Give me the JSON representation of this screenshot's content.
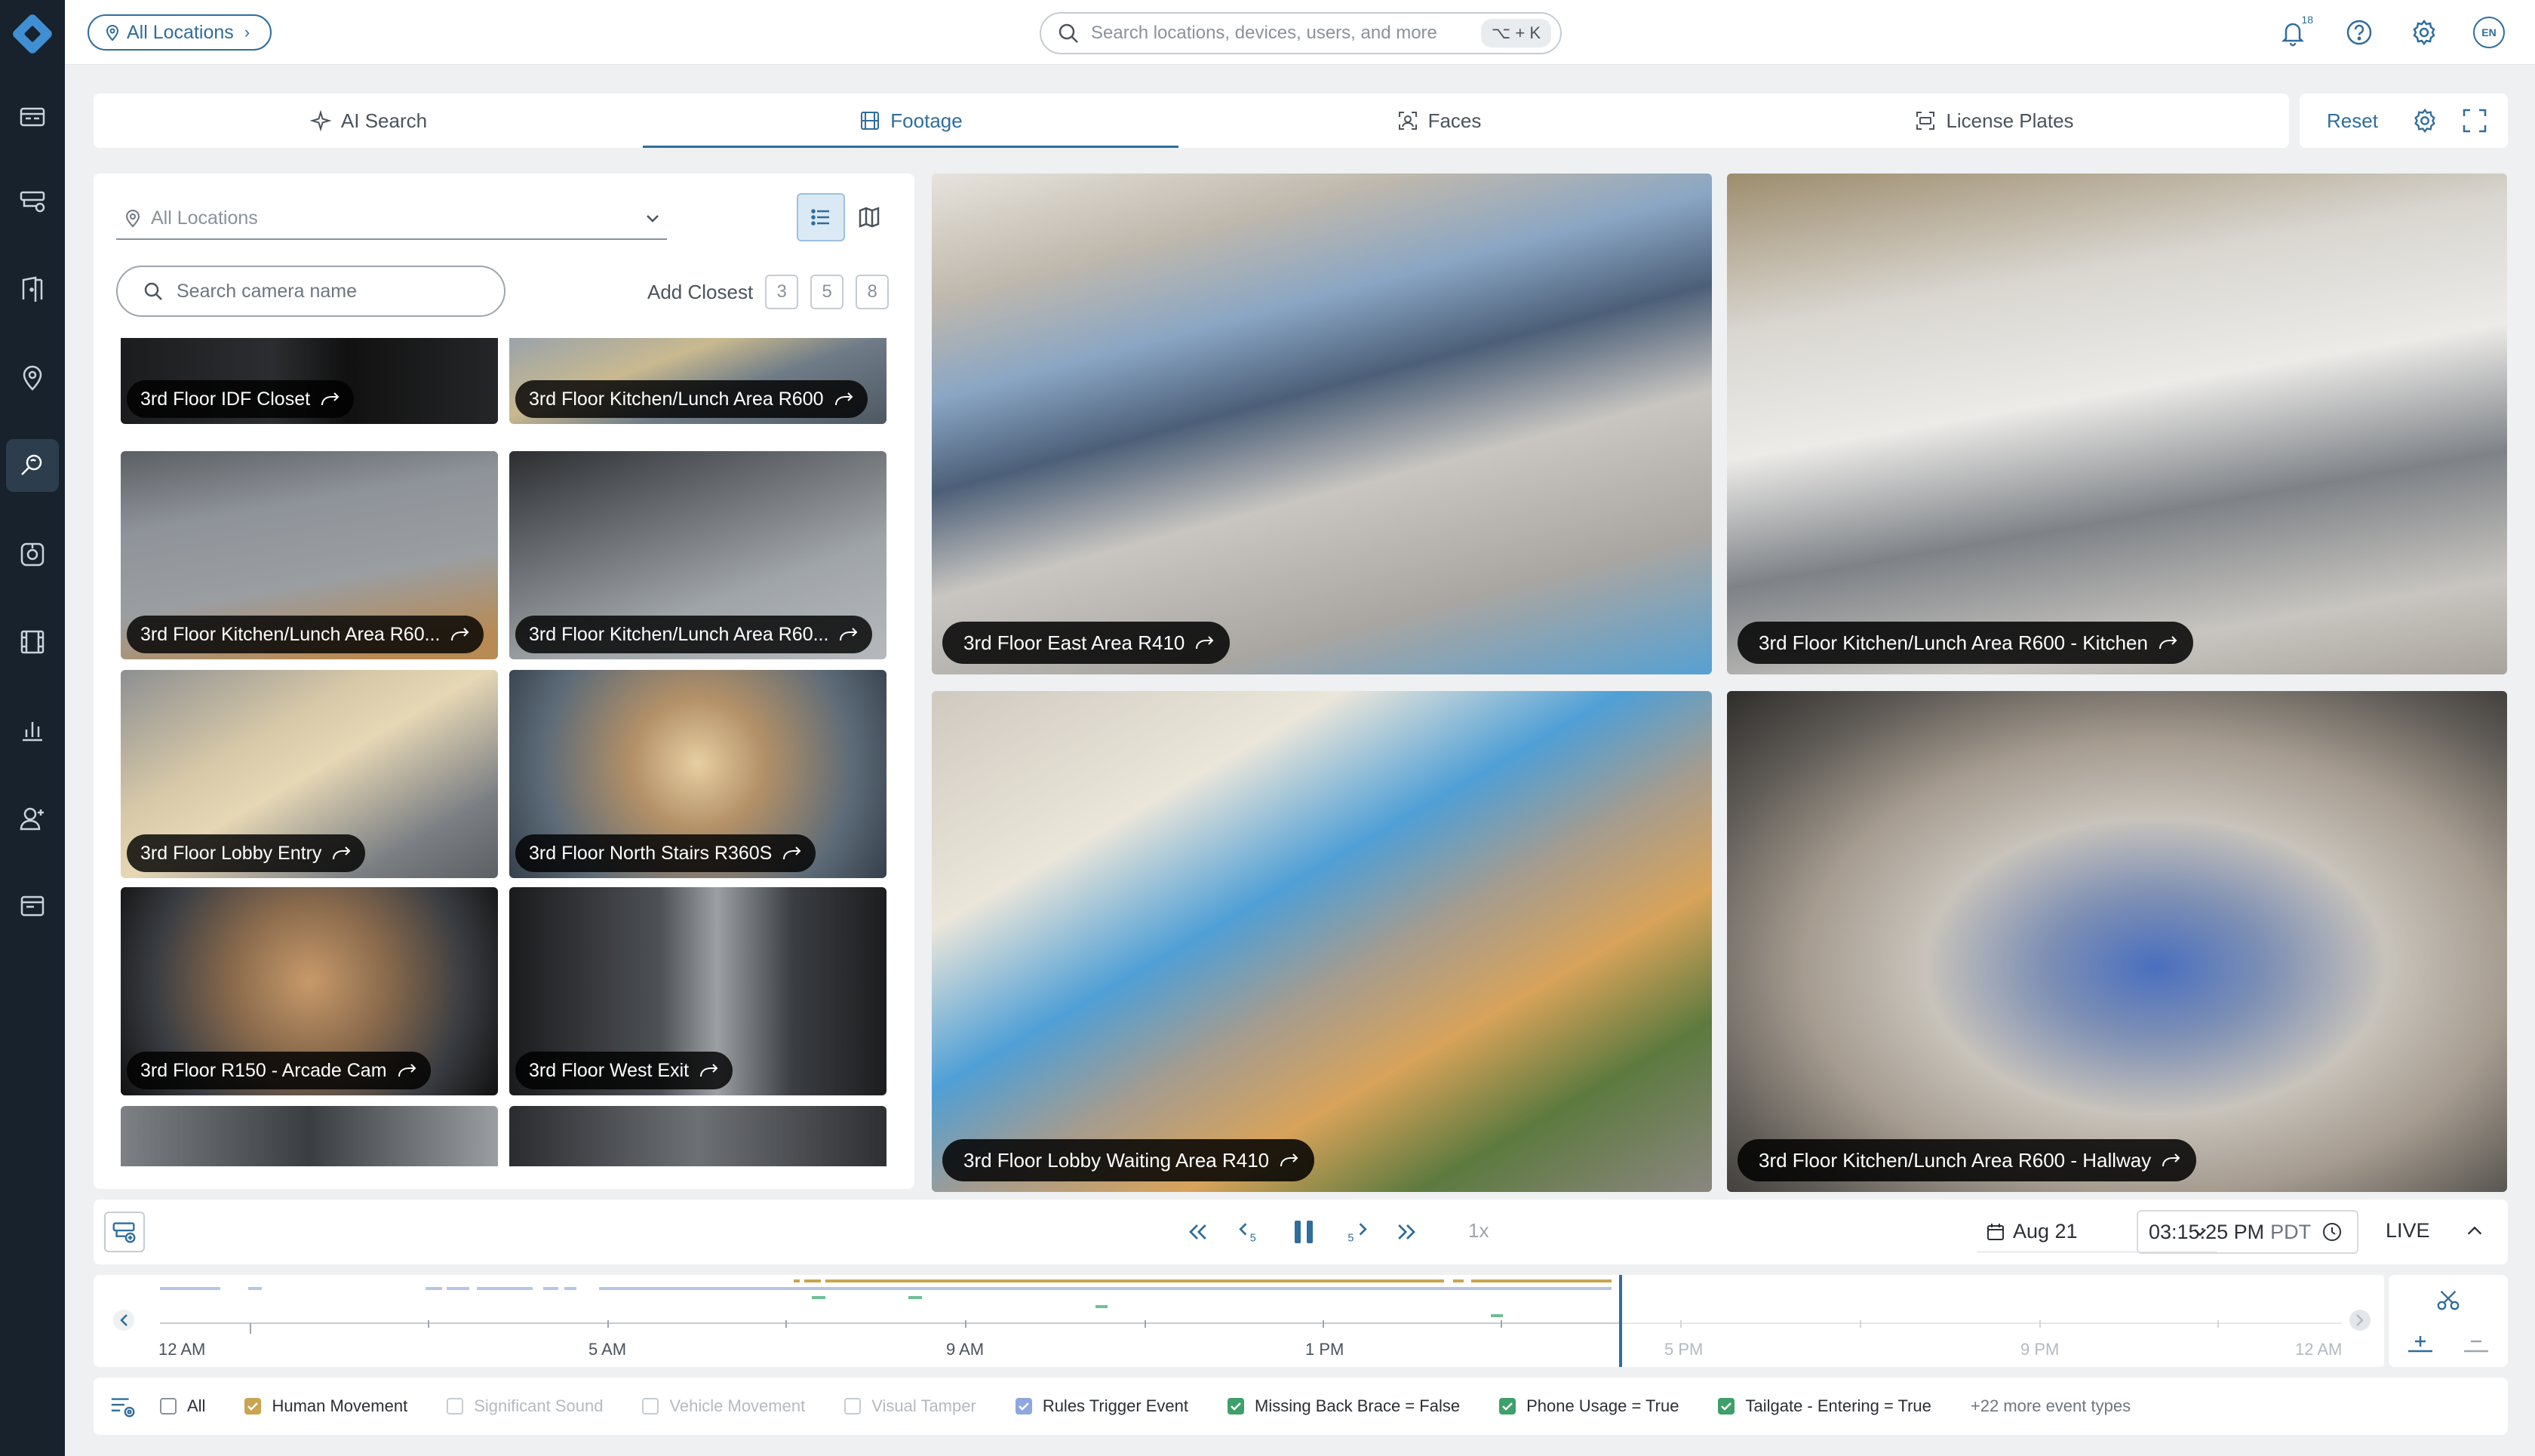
{
  "rail": {
    "items": [
      {
        "name": "dashboard-icon",
        "active": false
      },
      {
        "name": "devices-icon",
        "active": false
      },
      {
        "name": "access-door-icon",
        "active": false
      },
      {
        "name": "locations-pin-icon",
        "active": false
      },
      {
        "name": "investigate-search-icon",
        "active": true
      },
      {
        "name": "alarms-icon",
        "active": false
      },
      {
        "name": "footage-film-icon",
        "active": false
      },
      {
        "name": "analytics-chart-icon",
        "active": false
      },
      {
        "name": "add-user-icon",
        "active": false
      },
      {
        "name": "apps-window-icon",
        "active": false
      }
    ]
  },
  "topbar": {
    "location_label": "All Locations",
    "search_placeholder": "Search locations, devices, users, and more",
    "shortcut": "⌥ + K",
    "notification_count": "18",
    "language": "EN"
  },
  "tabs": [
    {
      "label": "AI Search",
      "active": false
    },
    {
      "label": "Footage",
      "active": true
    },
    {
      "label": "Faces",
      "active": false
    },
    {
      "label": "License Plates",
      "active": false
    }
  ],
  "tab_actions": {
    "reset_label": "Reset"
  },
  "left_panel": {
    "location_placeholder": "All Locations",
    "camera_search_placeholder": "Search camera name",
    "add_closest_label": "Add Closest",
    "add_closest_options": [
      "3",
      "5",
      "8"
    ],
    "cameras": [
      {
        "label": "3rd Floor IDF Closet"
      },
      {
        "label": "3rd Floor Kitchen/Lunch Area R600"
      },
      {
        "label": "3rd Floor Kitchen/Lunch Area R60..."
      },
      {
        "label": "3rd Floor Kitchen/Lunch Area R60..."
      },
      {
        "label": "3rd Floor Lobby Entry"
      },
      {
        "label": "3rd Floor North Stairs R360S"
      },
      {
        "label": "3rd Floor R150 - Arcade Cam"
      },
      {
        "label": "3rd Floor West Exit"
      }
    ]
  },
  "videos": [
    {
      "label": "3rd Floor East Area R410"
    },
    {
      "label": "3rd Floor Kitchen/Lunch Area R600 - Kitchen"
    },
    {
      "label": "3rd Floor Lobby Waiting Area R410"
    },
    {
      "label": "3rd Floor Kitchen/Lunch Area R600 - Hallway"
    }
  ],
  "playback": {
    "speed": "1x",
    "date": "Aug 21",
    "time": "03:15:25 PM",
    "timezone": "PDT",
    "live_label": "LIVE"
  },
  "timeline": {
    "ticks": [
      "12 AM",
      "5 AM",
      "9 AM",
      "1 PM",
      "5 PM",
      "9 PM",
      "12 AM"
    ],
    "colors": {
      "motion": "#b7c6e6",
      "rules": "#c9a451",
      "green": "#6fbf95",
      "cursor": "#2f6d9c"
    }
  },
  "filters": [
    {
      "label": "All",
      "checked": false,
      "disabled": false,
      "color": "#8a929c"
    },
    {
      "label": "Human Movement",
      "checked": true,
      "disabled": false,
      "color": "#c9a451"
    },
    {
      "label": "Significant Sound",
      "checked": false,
      "disabled": true,
      "color": "#c6ccd3"
    },
    {
      "label": "Vehicle Movement",
      "checked": false,
      "disabled": true,
      "color": "#c6ccd3"
    },
    {
      "label": "Visual Tamper",
      "checked": false,
      "disabled": true,
      "color": "#c6ccd3"
    },
    {
      "label": "Rules Trigger Event",
      "checked": true,
      "disabled": false,
      "color": "#8fa6e0"
    },
    {
      "label": "Missing Back Brace = False",
      "checked": true,
      "disabled": false,
      "color": "#3ea06a"
    },
    {
      "label": "Phone Usage = True",
      "checked": true,
      "disabled": false,
      "color": "#3ea06a"
    },
    {
      "label": "Tailgate - Entering = True",
      "checked": true,
      "disabled": false,
      "color": "#3ea06a"
    }
  ],
  "more_event_types": "+22 more event types"
}
